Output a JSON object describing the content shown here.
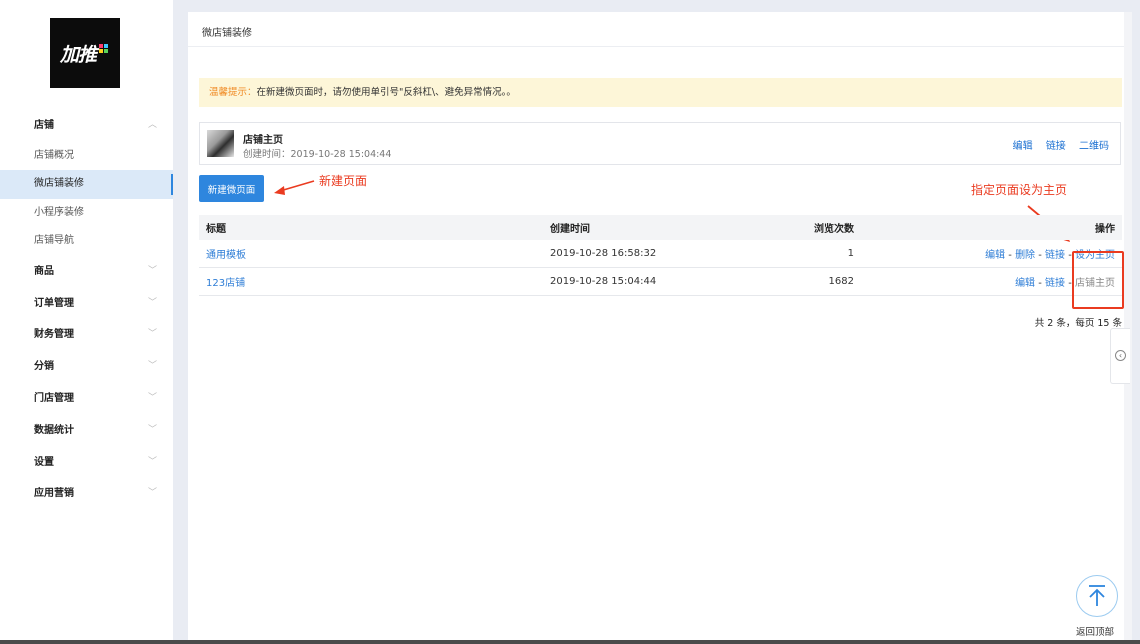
{
  "logo": {
    "text": "加推"
  },
  "sidebar": {
    "items": [
      {
        "label": "店铺",
        "kind": "group",
        "chevron": "︿"
      },
      {
        "label": "店铺概况",
        "kind": "sub"
      },
      {
        "label": "微店铺装修",
        "kind": "sub",
        "active": true
      },
      {
        "label": "小程序装修",
        "kind": "sub"
      },
      {
        "label": "店铺导航",
        "kind": "sub"
      },
      {
        "label": "商品",
        "kind": "group",
        "chevron": "﹀"
      },
      {
        "label": "订单管理",
        "kind": "group",
        "chevron": "﹀"
      },
      {
        "label": "财务管理",
        "kind": "group",
        "chevron": "﹀"
      },
      {
        "label": "分销",
        "kind": "group",
        "chevron": "﹀"
      },
      {
        "label": "门店管理",
        "kind": "group",
        "chevron": "﹀"
      },
      {
        "label": "数据统计",
        "kind": "group",
        "chevron": "﹀"
      },
      {
        "label": "设置",
        "kind": "group",
        "chevron": "﹀"
      },
      {
        "label": "应用营销",
        "kind": "group",
        "chevron": "﹀"
      }
    ]
  },
  "main": {
    "title": "微店铺装修",
    "tip": {
      "label": "温馨提示：",
      "text": "在新建微页面时，请勿使用单引号\"反斜杠\\、避免异常情况。。"
    },
    "home": {
      "name": "店铺主页",
      "time": "创建时间：2019-10-28 15:04:44",
      "actions": [
        "编辑",
        "链接",
        "二维码"
      ]
    },
    "new_button": "新建微页面",
    "table": {
      "headers": [
        "标题",
        "创建时间",
        "浏览次数",
        "操作"
      ],
      "rows": [
        {
          "title": "通用模板",
          "created": "2019-10-28 16:58:32",
          "views": "1",
          "ops": [
            "编辑",
            "删除",
            "链接"
          ],
          "home_op": "设为主页",
          "home_op_link": true
        },
        {
          "title": "123店铺",
          "created": "2019-10-28 15:04:44",
          "views": "1682",
          "ops": [
            "编辑",
            "链接"
          ],
          "home_op": "店铺主页",
          "home_op_link": false
        }
      ],
      "separator": " - "
    },
    "pager": "共 2 条，每页 15 条"
  },
  "annotations": {
    "new_page": "新建页面",
    "set_home": "指定页面设为主页"
  },
  "back_to_top": {
    "label": "返回顶部",
    "icon": "arrow-up-icon"
  },
  "colors": {
    "accent": "#2e86de",
    "annotation": "#ea3b20",
    "tip_bg": "#fdf6d8",
    "tip_label": "#f08a24"
  }
}
